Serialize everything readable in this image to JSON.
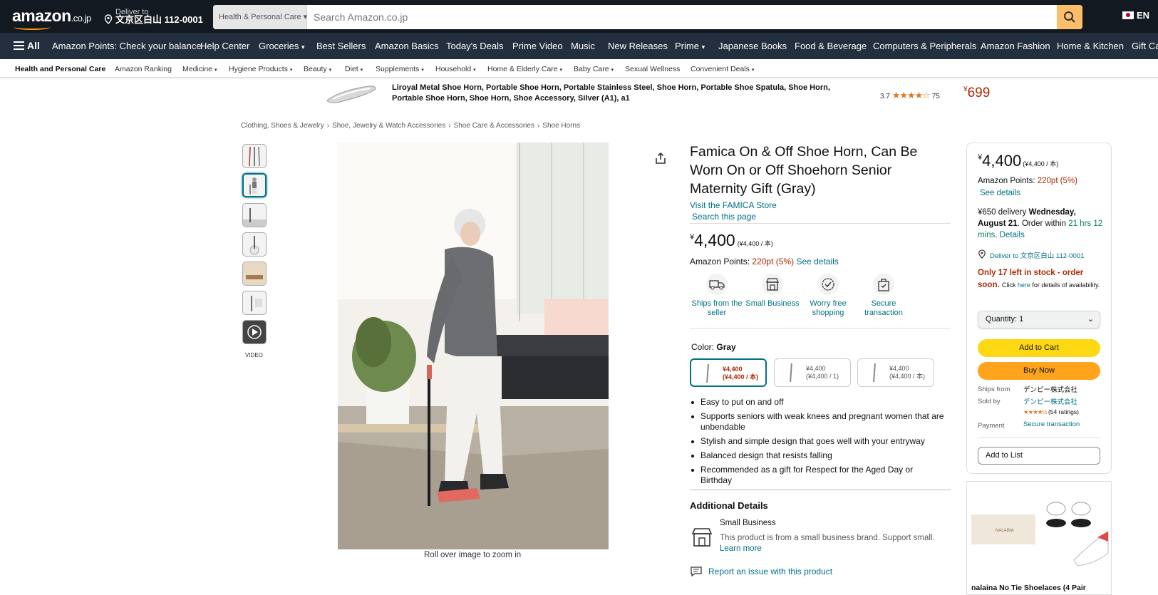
{
  "header": {
    "logo": "amazon",
    "logo_tld": ".co.jp",
    "deliver_to_label": "Deliver to",
    "deliver_to_address": "文京区白山 112-0001",
    "search_category": "Health & Personal Care",
    "search_placeholder": "Search Amazon.co.jp",
    "language": "EN"
  },
  "nav": {
    "all_label": "All",
    "items": [
      "Amazon Points: Check your balance",
      "Help Center",
      "Groceries",
      "Best Sellers",
      "Amazon Basics",
      "Today's Deals",
      "Prime Video",
      "Music",
      "New Releases",
      "Prime",
      "Japanese Books",
      "Food & Beverage",
      "Computers & Peripherals",
      "Amazon Fashion",
      "Home & Kitchen",
      "Gift Ca"
    ]
  },
  "subnav": {
    "items": [
      "Health and Personal Care",
      "Amazon Ranking",
      "Medicine",
      "Hygiene Products",
      "Beauty",
      "Diet",
      "Supplements",
      "Household",
      "Home & Elderly Care",
      "Baby Care",
      "Sexual Wellness",
      "Convenient Deals"
    ]
  },
  "promo": {
    "title": "Liroyal Metal Shoe Horn, Portable Shoe Horn, Portable Stainless Steel, Shoe Horn, Portable Shoe Spatula, Shoe Horn, Portable Shoe Horn, Shoe Horn, Shoe Accessory, Silver (A1), a1",
    "rating": "3.7",
    "rating_value": 3.7,
    "review_count": "75",
    "price": "699",
    "currency": "¥"
  },
  "breadcrumb": [
    "Clothing, Shoes & Jewelry",
    "Shoe, Jewelry & Watch Accessories",
    "Shoe Care & Accessories",
    "Shoe Horns"
  ],
  "gallery": {
    "video_label": "VIDEO",
    "zoom_hint": "Roll over image to zoom in"
  },
  "product": {
    "title": "Famica On & Off Shoe Horn, Can Be Worn On or Off Shoehorn Senior Maternity Gift (Gray)",
    "store_link": "Visit the FAMICA Store",
    "search_link": "Search this page",
    "currency": "¥",
    "price": "4,400",
    "unit_price": "(¥4,400 / 本)",
    "points_label": "Amazon Points:",
    "points_value": "220pt  (5%)",
    "points_link": "See details",
    "features": [
      "Ships from the seller",
      "Small Business",
      "Worry free shopping",
      "Secure transaction"
    ],
    "color_label": "Color:",
    "color_value": "Gray",
    "variants": [
      {
        "price": "¥4,400",
        "unit": "(¥4,400 / 本)"
      },
      {
        "price": "¥4,400",
        "unit": "(¥4,400 / 1)"
      },
      {
        "price": "¥4,400",
        "unit": "(¥4,400 / 本)"
      }
    ],
    "bullets": [
      "Easy to put on and off",
      "Supports seniors with weak knees and pregnant women that are unbendable",
      "Stylish and simple design that goes well with your entryway",
      "Balanced design that resists falling",
      "Recommended as a gift for Respect for the Aged Day or Birthday"
    ],
    "additional_details": "Additional Details",
    "small_business_title": "Small Business",
    "small_business_desc": "This product is from a small business brand. Support small.",
    "learn_more": "Learn more",
    "report_issue": "Report an issue with this product"
  },
  "buybox": {
    "currency": "¥",
    "price": "4,400",
    "unit_price": "(¥4,400 / 本)",
    "points_label": "Amazon Points:",
    "points_value": "220pt  (5%)",
    "see_details": "See details",
    "delivery_fee": "¥650 delivery",
    "delivery_date": "Wednesday, August 21",
    "order_within": ". Order within",
    "countdown": "21 hrs 12 mins",
    "details_link": "Details",
    "deliver_to": "Deliver to 文京区白山 112-0001",
    "stock_warning": "Only 17 left in stock - order soon.",
    "stock_click": "Click",
    "stock_here": "here",
    "stock_suffix": "for details of availability.",
    "quantity_label": "Quantity:",
    "quantity_value": "1",
    "add_to_cart": "Add to Cart",
    "buy_now": "Buy Now",
    "ships_from_label": "Ships from",
    "ships_from_value": "デンピー株式会社",
    "sold_by_label": "Sold by",
    "sold_by_value": "デンピー株式会社",
    "seller_rating_value": 4.5,
    "seller_ratings": "(54 ratings)",
    "payment_label": "Payment",
    "payment_value": "Secure transaction",
    "add_to_list": "Add to List"
  },
  "ad": {
    "caption": "nalaina No Tie Shoelaces (4 Pair"
  },
  "colors": {
    "header_bg": "#131921",
    "nav_bg": "#232f3e",
    "accent": "#ff9900",
    "link": "#007185",
    "price_red": "#b12704",
    "cart_yellow": "#ffd814",
    "buy_orange": "#ffa41c"
  }
}
